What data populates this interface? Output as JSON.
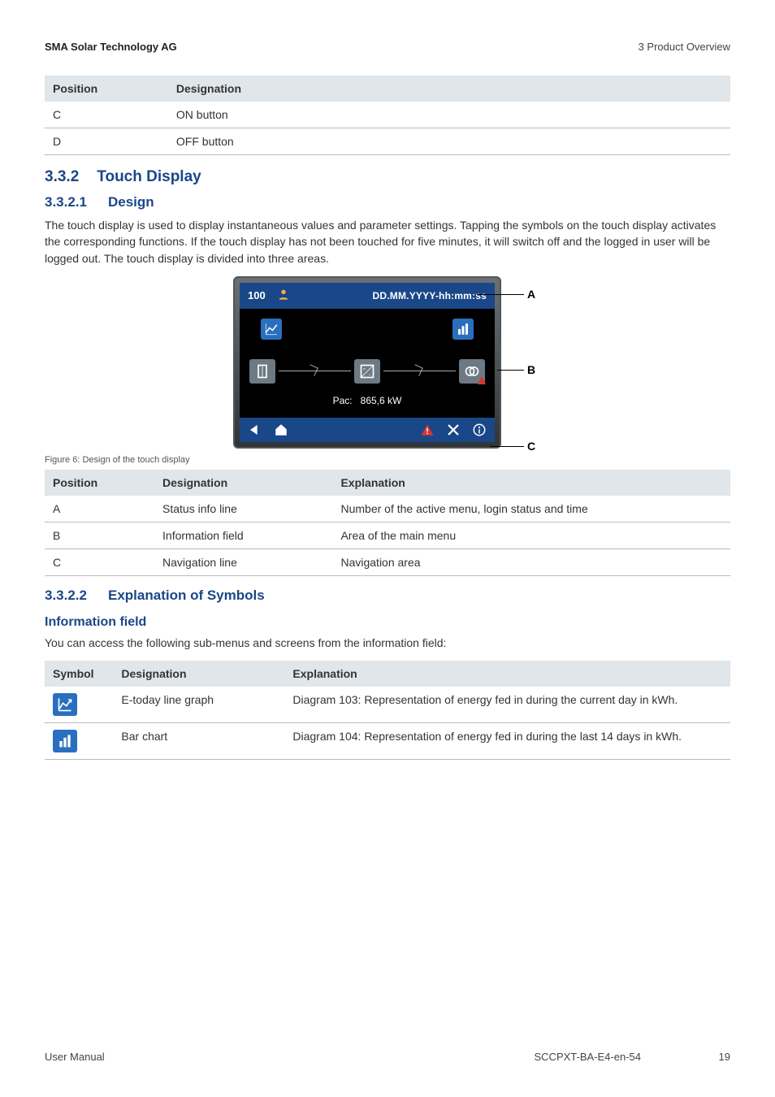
{
  "header": {
    "left": "SMA Solar Technology AG",
    "right": "3 Product Overview"
  },
  "table1": {
    "headers": {
      "position": "Position",
      "designation": "Designation"
    },
    "rows": [
      {
        "position": "C",
        "designation": "ON button"
      },
      {
        "position": "D",
        "designation": "OFF button"
      }
    ]
  },
  "section_332": {
    "number": "3.3.2",
    "title": "Touch Display"
  },
  "section_3321": {
    "number": "3.3.2.1",
    "title": "Design"
  },
  "para_design": "The touch display is used to display instantaneous values and parameter settings. Tapping the symbols on the touch display activates the corresponding functions. If the touch display has not been touched for five minutes, it will switch off and the logged in user will be logged out. The touch display is divided into three areas.",
  "figure": {
    "statusbar": {
      "menu": "100",
      "datetime": "DD.MM.YYYY-hh:mm:ss"
    },
    "pac_label": "Pac:",
    "pac_value": "865,6 kW",
    "callouts": {
      "a": "A",
      "b": "B",
      "c": "C"
    },
    "caption": "Figure 6: Design of the touch display"
  },
  "table2": {
    "headers": {
      "position": "Position",
      "designation": "Designation",
      "explanation": "Explanation"
    },
    "rows": [
      {
        "position": "A",
        "designation": "Status info line",
        "explanation": "Number of the active menu, login status and time"
      },
      {
        "position": "B",
        "designation": "Information field",
        "explanation": "Area of the main menu"
      },
      {
        "position": "C",
        "designation": "Navigation line",
        "explanation": "Navigation area"
      }
    ]
  },
  "section_3322": {
    "number": "3.3.2.2",
    "title": "Explanation of Symbols"
  },
  "info_field_heading": "Information field",
  "para_info": "You can access the following sub-menus and screens from the information field:",
  "table3": {
    "headers": {
      "symbol": "Symbol",
      "designation": "Designation",
      "explanation": "Explanation"
    },
    "rows": [
      {
        "designation": "E-today line graph",
        "explanation": "Diagram 103: Representation of energy fed in during the current day in kWh."
      },
      {
        "designation": "Bar chart",
        "explanation": "Diagram 104: Representation of energy fed in during the last 14 days in kWh."
      }
    ]
  },
  "footer": {
    "left": "User Manual",
    "center": "SCCPXT-BA-E4-en-54",
    "right": "19"
  }
}
